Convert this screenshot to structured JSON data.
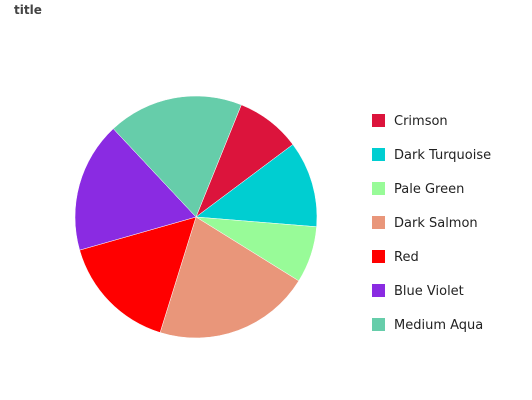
{
  "chart_data": {
    "type": "pie",
    "title": "title",
    "legend_position": "right",
    "slices": [
      {
        "label": "Crimson",
        "value": 7.9,
        "color": "#DC143C"
      },
      {
        "label": "Dark Turquoise",
        "value": 10.5,
        "color": "#00CED1"
      },
      {
        "label": "Pale Green",
        "value": 6.9,
        "color": "#98FB98"
      },
      {
        "label": "Dark Salmon",
        "value": 19.1,
        "color": "#E9967A"
      },
      {
        "label": "Red",
        "value": 14.4,
        "color": "#FF0000"
      },
      {
        "label": "Blue Violet",
        "value": 15.9,
        "color": "#8A2BE2"
      },
      {
        "label": "Medium Aqua",
        "value": 16.5,
        "color": "#66CDAA"
      }
    ]
  }
}
